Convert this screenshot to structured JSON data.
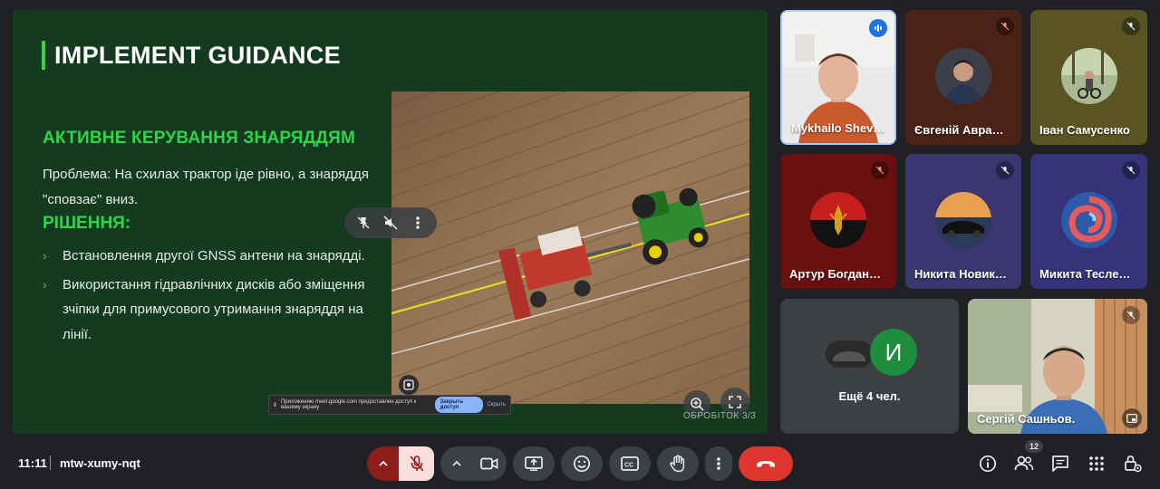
{
  "slide": {
    "title": "IMPLEMENT GUIDANCE",
    "subheading": "АКТИВНЕ КЕРУВАННЯ ЗНАРЯДДЯМ",
    "problem": "Проблема: На схилах трактор іде рівно, а знаряддя \"сповзає\" вниз.",
    "solution_heading": "РІШЕННЯ:",
    "bullets": [
      "Встановлення другої GNSS антени на знаряддi.",
      "Використання гідравлічних дисків або зміщення зчіпки для примусового утримання знаряддя на лінії."
    ],
    "counter": "ОБРОБІТОК 3/3",
    "accent_color": "#2fd44a"
  },
  "share_banner": {
    "text": "Приложению meet.google.com предоставлен доступ к вашему экрану",
    "stop_label": "Закрыть доступ",
    "hide_label": "Скрыть"
  },
  "participants": [
    {
      "name": "Mykhailo Shev…",
      "state": "speaking"
    },
    {
      "name": "Євгеній Авра…",
      "state": "muted"
    },
    {
      "name": "Іван Самусенко",
      "state": "muted"
    },
    {
      "name": "Артур Богдан…",
      "state": "muted"
    },
    {
      "name": "Никита Новик…",
      "state": "muted"
    },
    {
      "name": "Микита Тесле…",
      "state": "muted"
    },
    {
      "name": "Сергій Сашньов.",
      "state": "muted"
    }
  ],
  "more_tile": {
    "label": "Ещё 4 чел.",
    "initial": "И"
  },
  "bottom_bar": {
    "time": "11:11",
    "meeting_code": "mtw-xumy-nqt",
    "people_count": "12"
  }
}
